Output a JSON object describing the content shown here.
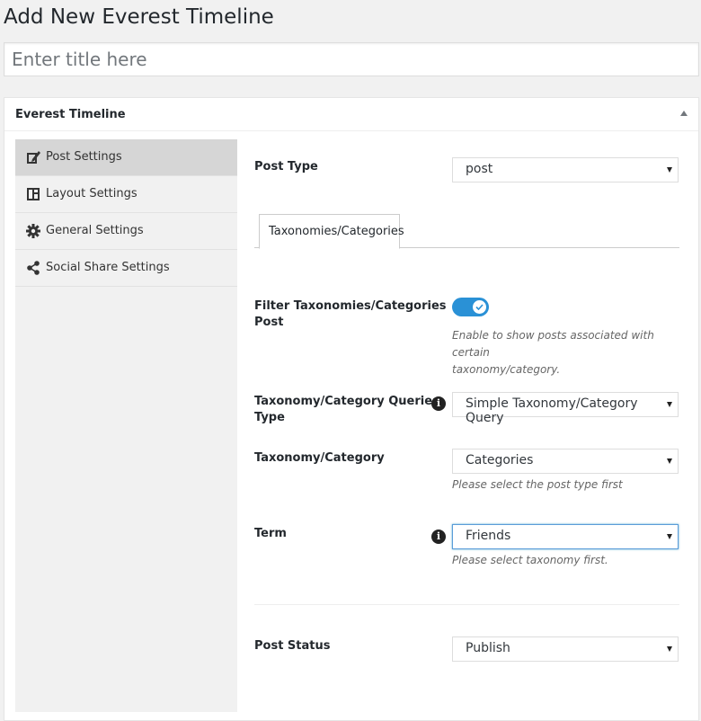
{
  "page": {
    "title": "Add New Everest Timeline"
  },
  "title_input": {
    "placeholder": "Enter title here"
  },
  "metabox": {
    "title": "Everest Timeline"
  },
  "nav": {
    "items": [
      {
        "label": "Post Settings",
        "icon": "edit-icon",
        "active": true
      },
      {
        "label": "Layout Settings",
        "icon": "layout-icon",
        "active": false
      },
      {
        "label": "General Settings",
        "icon": "gear-icon",
        "active": false
      },
      {
        "label": "Social Share Settings",
        "icon": "share-icon",
        "active": false
      }
    ]
  },
  "fields": {
    "post_type": {
      "label": "Post Type",
      "value": "post"
    },
    "tab": {
      "label": "Taxonomies/Categories"
    },
    "filter": {
      "label_line1": "Filter Taxonomies/Categories",
      "label_line2": "Post",
      "enabled": true,
      "desc_line1": "Enable to show posts associated with certain",
      "desc_line2": "taxonomy/category."
    },
    "query_type": {
      "label_line1": "Taxonomy/Category Queries",
      "label_line2": "Type",
      "value": "Simple Taxonomy/Category Query"
    },
    "taxonomy": {
      "label": "Taxonomy/Category",
      "value": "Categories",
      "desc": "Please select the post type first"
    },
    "term": {
      "label": "Term",
      "value": "Friends",
      "desc": "Please select taxonomy first."
    },
    "post_status": {
      "label": "Post Status",
      "value": "Publish"
    }
  },
  "colors": {
    "accent": "#2a91d6",
    "nav_active": "#d6d6d6",
    "nav_bg": "#f1f1f1"
  }
}
